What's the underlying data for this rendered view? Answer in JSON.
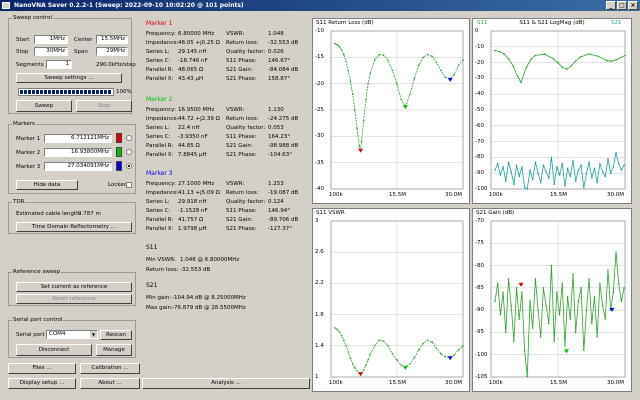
{
  "window": {
    "title": "NanoVNA Saver 0.2.2-1 (Sweep: 2022-09-10 10:02:20 @ 101 points)"
  },
  "sweep_control": {
    "title": "Sweep control",
    "start_label": "Start",
    "start_value": "1MHz",
    "stop_label": "Stop",
    "stop_value": "30MHz",
    "center_label": "Center",
    "center_value": "15.5MHz",
    "span_label": "Span",
    "span_value": "29MHz",
    "segments_label": "Segments",
    "segments_value": "1",
    "step_text": "290.0kHz/step",
    "settings_button": "Sweep settings ...",
    "progress_value": 100,
    "progress_text": "100%",
    "sweep_button": "Sweep",
    "stop_button": "Stop"
  },
  "markers_panel": {
    "title": "Markers",
    "items": [
      {
        "label": "Marker 1",
        "value": "6.712121MHz",
        "color": "#e00000",
        "selected": false
      },
      {
        "label": "Marker 2",
        "value": "16.93800MHz",
        "color": "#00c000",
        "selected": false
      },
      {
        "label": "Marker 3",
        "value": "27.034091MHz",
        "color": "#0000e0",
        "selected": true
      }
    ],
    "hide_data_button": "Hide data",
    "locked_label": "Locked",
    "locked": false
  },
  "tdr": {
    "title": "TDR",
    "cable_label": "Estimated cable length:",
    "cable_value": "9.787 m",
    "tdr_button": "Time Domain Reflectometry ..."
  },
  "reference": {
    "title": "Reference sweep",
    "set_button": "Set current as reference",
    "reset_button": "Reset reference"
  },
  "serial": {
    "title": "Serial port control",
    "port_label": "Serial port",
    "port_value": "COM4",
    "rescan_button": "Rescan",
    "disconnect_button": "Disconnect",
    "manage_button": "Manage"
  },
  "bottom_buttons": {
    "files": "Files ...",
    "calibration": "Calibration ...",
    "display": "Display setup ...",
    "about": "About ...",
    "analysis": "Analysis ..."
  },
  "marker_details": [
    {
      "title": "Marker 1",
      "color": "#e00000",
      "left": [
        [
          "Frequency:",
          "6.80000 MHz"
        ],
        [
          "Impedance:",
          "48.05 +j0.25 Ω"
        ],
        [
          "Series L:",
          "29.145 nH"
        ],
        [
          "Series C:",
          "-18.746 nF"
        ],
        [
          "Parallel R:",
          "48.065 Ω"
        ],
        [
          "Parallel X:",
          "43.43 μH"
        ]
      ],
      "right": [
        [
          "VSWR:",
          "1.048"
        ],
        [
          "Return loss:",
          "-32.553 dB"
        ],
        [
          "Quality factor:",
          "0.026"
        ],
        [
          "S11 Phase:",
          "146.67°"
        ],
        [
          "S21 Gain:",
          "-84.084 dB"
        ],
        [
          "S21 Phase:",
          "158.87°"
        ]
      ]
    },
    {
      "title": "Marker 2",
      "color": "#00c000",
      "left": [
        [
          "Frequency:",
          "16.9500 MHz"
        ],
        [
          "Impedance:",
          "44.72 +j2.39 Ω"
        ],
        [
          "Series L:",
          "22.4 nH"
        ],
        [
          "Series C:",
          "-3.9350 nF"
        ],
        [
          "Parallel R:",
          "44.85 Ω"
        ],
        [
          "Parallel X:",
          "7.8845 μH"
        ]
      ],
      "right": [
        [
          "VSWR:",
          "1.130"
        ],
        [
          "Return loss:",
          "-24.275 dB"
        ],
        [
          "Quality factor:",
          "0.053"
        ],
        [
          "S11 Phase:",
          "164.23°"
        ],
        [
          "S21 Gain:",
          "-98.988 dB"
        ],
        [
          "S21 Phase:",
          "-104.63°"
        ]
      ]
    },
    {
      "title": "Marker 3",
      "color": "#0000e0",
      "left": [
        [
          "Frequency:",
          "27.1000 MHz"
        ],
        [
          "Impedance:",
          "41.13 +j5.09 Ω"
        ],
        [
          "Series L:",
          "29.918 nH"
        ],
        [
          "Series C:",
          "-1.1528 nF"
        ],
        [
          "Parallel R:",
          "41.757 Ω"
        ],
        [
          "Parallel X:",
          "1.9798 μH"
        ]
      ],
      "right": [
        [
          "VSWR:",
          "1.253"
        ],
        [
          "Return loss:",
          "-19.087 dB"
        ],
        [
          "Quality factor:",
          "0.124"
        ],
        [
          "S11 Phase:",
          "146.94°"
        ],
        [
          "S21 Gain:",
          "-89.706 dB"
        ],
        [
          "S21 Phase:",
          "-127.37°"
        ]
      ]
    }
  ],
  "s11_summary": {
    "title": "S11",
    "min_vswr_label": "Min VSWR:",
    "min_vswr_value": "1.048 @ 6.80000MHz",
    "return_loss_label": "Return loss:",
    "return_loss_value": "-32.553 dB"
  },
  "s21_summary": {
    "title": "S21",
    "min_gain_label": "Min gain:",
    "min_gain_value": "-104.94 dB @ 8.25000MHz",
    "max_gain_label": "Max gain:",
    "max_gain_value": "-76.879 dB @ 28.5500MHz"
  },
  "chart_data": [
    {
      "type": "line",
      "title": "S11 Return Loss (dB)",
      "x_ticks": [
        "100k",
        "15.5M",
        "30.0M"
      ],
      "xlim": [
        0.1,
        30.0
      ],
      "ylim": [
        -40,
        -10
      ],
      "y_ticks": [
        -10,
        -15,
        -20,
        -25,
        -30,
        -35,
        -40
      ],
      "series": [
        {
          "x": [
            1,
            1.5,
            2,
            2.5,
            3,
            3.5,
            4,
            4.5,
            5,
            5.5,
            6,
            6.5,
            6.8,
            7,
            7.5,
            8,
            8.5,
            9,
            10,
            11,
            12,
            13,
            14,
            15,
            16,
            17,
            18,
            19,
            20,
            21,
            22,
            23,
            24,
            25,
            26,
            27,
            28,
            29,
            30
          ],
          "values": [
            -12.4,
            -12.6,
            -13,
            -13.6,
            -14.5,
            -15.8,
            -17.5,
            -19.5,
            -22,
            -25,
            -28.5,
            -31.8,
            -32.6,
            -31,
            -27,
            -23,
            -20,
            -18,
            -15.5,
            -14.5,
            -14.6,
            -15.5,
            -17.5,
            -20,
            -23,
            -24.3,
            -22,
            -19,
            -16.5,
            -15,
            -14.5,
            -14.8,
            -16,
            -17.5,
            -18.8,
            -19.1,
            -18.3,
            -16.5,
            -15.5
          ]
        }
      ],
      "markers": [
        {
          "x": 6.8,
          "y": -32.553,
          "color": "#e00000"
        },
        {
          "x": 16.95,
          "y": -24.275,
          "color": "#00c000"
        },
        {
          "x": 27.1,
          "y": -19.087,
          "color": "#0000e0"
        }
      ]
    },
    {
      "type": "line",
      "title": "S11 & S21 LogMag (dB)",
      "legend": [
        "S11",
        "S21"
      ],
      "x_ticks": [
        "100k",
        "15.5M",
        "30.0M"
      ],
      "xlim": [
        0.1,
        30.0
      ],
      "ylim": [
        -100,
        0
      ],
      "y_ticks": [
        0,
        -10,
        -20,
        -30,
        -40,
        -50,
        -60,
        -70,
        -80,
        -90,
        -100
      ],
      "series": [
        {
          "name": "S11",
          "x": [
            1,
            2,
            3,
            4,
            5,
            6,
            6.8,
            8,
            9,
            10,
            12,
            14,
            15,
            16,
            17,
            18,
            19,
            20,
            22,
            24,
            26,
            27,
            28,
            30
          ],
          "values": [
            -12.4,
            -13,
            -14.5,
            -17.5,
            -22,
            -28.5,
            -32.6,
            -23,
            -18,
            -15.5,
            -14.6,
            -17.5,
            -20,
            -23,
            -24.3,
            -22,
            -19,
            -16.5,
            -14.5,
            -16,
            -18.8,
            -19.1,
            -18.3,
            -15.5
          ]
        },
        {
          "name": "S21",
          "x": [
            1,
            1.6,
            2.2,
            2.8,
            3.4,
            4,
            4.6,
            5.2,
            5.8,
            6.4,
            7,
            7.6,
            8.2,
            8.8,
            9.4,
            10,
            10.6,
            11.2,
            11.8,
            12.4,
            13,
            13.6,
            14.2,
            14.8,
            15.4,
            16,
            16.6,
            17.2,
            17.8,
            18.4,
            19,
            19.6,
            20.2,
            20.8,
            21.4,
            22,
            22.6,
            23.2,
            23.8,
            24.4,
            25,
            25.6,
            26.2,
            26.8,
            27.4,
            28,
            28.6,
            29.2,
            29.8
          ],
          "values": [
            -88,
            -84,
            -91,
            -86,
            -95,
            -83,
            -89,
            -97,
            -85,
            -92,
            -86,
            -99,
            -104.9,
            -88,
            -94,
            -83,
            -90,
            -96,
            -85,
            -89,
            -93,
            -80,
            -97,
            -86,
            -91,
            -84,
            -98,
            -87,
            -92,
            -82,
            -95,
            -88,
            -85,
            -99,
            -90,
            -83,
            -93,
            -87,
            -96,
            -84,
            -89,
            -92,
            -81,
            -90,
            -86,
            -77,
            -84,
            -88,
            -85
          ]
        }
      ]
    },
    {
      "type": "line",
      "title": "S11 VSWR",
      "x_ticks": [
        "100k",
        "15.5M",
        "30.0M"
      ],
      "xlim": [
        0.1,
        30.0
      ],
      "ylim": [
        1.0,
        3.0
      ],
      "y_ticks": [
        3,
        2.6,
        2.2,
        1.8,
        1.4,
        1.0
      ],
      "series": [
        {
          "x": [
            1,
            1.5,
            2,
            2.5,
            3,
            3.5,
            4,
            4.5,
            5,
            5.5,
            6,
            6.5,
            6.8,
            7,
            7.5,
            8,
            8.5,
            9,
            10,
            11,
            12,
            13,
            14,
            15,
            16,
            17,
            18,
            19,
            20,
            21,
            22,
            23,
            24,
            25,
            26,
            27,
            28,
            29,
            30
          ],
          "values": [
            1.63,
            1.61,
            1.58,
            1.53,
            1.47,
            1.4,
            1.32,
            1.24,
            1.17,
            1.12,
            1.08,
            1.05,
            1.048,
            1.06,
            1.09,
            1.15,
            1.22,
            1.29,
            1.4,
            1.47,
            1.46,
            1.4,
            1.3,
            1.22,
            1.15,
            1.13,
            1.17,
            1.25,
            1.35,
            1.43,
            1.47,
            1.45,
            1.37,
            1.3,
            1.26,
            1.253,
            1.28,
            1.35,
            1.4
          ]
        }
      ],
      "markers": [
        {
          "x": 6.8,
          "y": 1.048,
          "color": "#e00000"
        },
        {
          "x": 16.95,
          "y": 1.13,
          "color": "#00c000"
        },
        {
          "x": 27.1,
          "y": 1.253,
          "color": "#0000e0"
        }
      ]
    },
    {
      "type": "line",
      "title": "S21 Gain (dB)",
      "x_ticks": [
        "100k",
        "15.5M",
        "30.0M"
      ],
      "xlim": [
        0.1,
        30.0
      ],
      "ylim": [
        -105,
        -70
      ],
      "y_ticks": [
        -70,
        -75,
        -80,
        -85,
        -90,
        -95,
        -100,
        -105
      ],
      "series": [
        {
          "x": [
            1,
            1.6,
            2.2,
            2.8,
            3.4,
            4,
            4.6,
            5.2,
            5.8,
            6.4,
            7,
            7.6,
            8.2,
            8.8,
            9.4,
            10,
            10.6,
            11.2,
            11.8,
            12.4,
            13,
            13.6,
            14.2,
            14.8,
            15.4,
            16,
            16.6,
            17.2,
            17.8,
            18.4,
            19,
            19.6,
            20.2,
            20.8,
            21.4,
            22,
            22.6,
            23.2,
            23.8,
            24.4,
            25,
            25.6,
            26.2,
            26.8,
            27.4,
            28,
            28.6,
            29.2,
            29.8
          ],
          "values": [
            -88,
            -84,
            -91,
            -86,
            -95,
            -83,
            -89,
            -97,
            -85,
            -92,
            -86,
            -99,
            -104.9,
            -88,
            -94,
            -83,
            -90,
            -96,
            -85,
            -89,
            -93,
            -80,
            -97,
            -86,
            -91,
            -84,
            -98,
            -87,
            -92,
            -82,
            -95,
            -88,
            -85,
            -99,
            -90,
            -83,
            -93,
            -87,
            -96,
            -84,
            -89,
            -92,
            -81,
            -90,
            -86,
            -77,
            -84,
            -88,
            -85
          ]
        }
      ],
      "markers": [
        {
          "x": 6.8,
          "y": -84.084,
          "color": "#e00000"
        },
        {
          "x": 16.95,
          "y": -98.988,
          "color": "#00c000"
        },
        {
          "x": 27.1,
          "y": -89.706,
          "color": "#0000e0"
        }
      ]
    }
  ]
}
